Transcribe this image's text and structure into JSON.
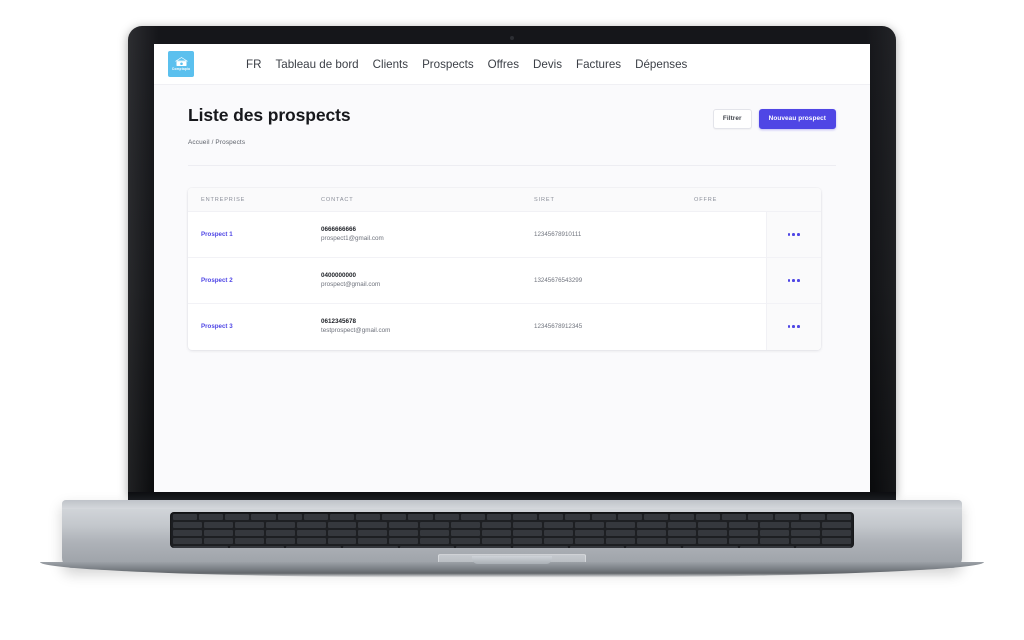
{
  "brand": {
    "logo_icon": "wallet-money-icon",
    "logo_word": "Comptapia",
    "accent_color": "#4f46e5",
    "logo_bg_color": "#5bc0ee"
  },
  "navbar": {
    "links": [
      {
        "label": "FR",
        "name": "nav-link-language"
      },
      {
        "label": "Tableau de bord",
        "name": "nav-link-dashboard"
      },
      {
        "label": "Clients",
        "name": "nav-link-clients"
      },
      {
        "label": "Prospects",
        "name": "nav-link-prospects"
      },
      {
        "label": "Offres",
        "name": "nav-link-offres"
      },
      {
        "label": "Devis",
        "name": "nav-link-devis"
      },
      {
        "label": "Factures",
        "name": "nav-link-factures"
      },
      {
        "label": "Dépenses",
        "name": "nav-link-depenses"
      }
    ]
  },
  "page": {
    "title": "Liste des prospects",
    "breadcrumb": "Accueil / Prospects",
    "filter_label": "Filtrer",
    "new_label": "Nouveau prospect"
  },
  "table": {
    "headers": {
      "entreprise": "ENTREPRISE",
      "contact": "CONTACT",
      "siret": "SIRET",
      "offre": "OFFRE"
    },
    "rows": [
      {
        "entreprise": "Prospect 1",
        "phone": "0666666666",
        "email": "prospect1@gmail.com",
        "siret": "12345678910111",
        "offre": "",
        "actions_icon": "ellipsis-horizontal-icon"
      },
      {
        "entreprise": "Prospect 2",
        "phone": "0400000000",
        "email": "prospect@gmail.com",
        "siret": "13245676543299",
        "offre": "",
        "actions_icon": "ellipsis-horizontal-icon"
      },
      {
        "entreprise": "Prospect 3",
        "phone": "0612345678",
        "email": "testprospect@gmail.com",
        "siret": "12345678912345",
        "offre": "",
        "actions_icon": "ellipsis-horizontal-icon"
      }
    ]
  }
}
